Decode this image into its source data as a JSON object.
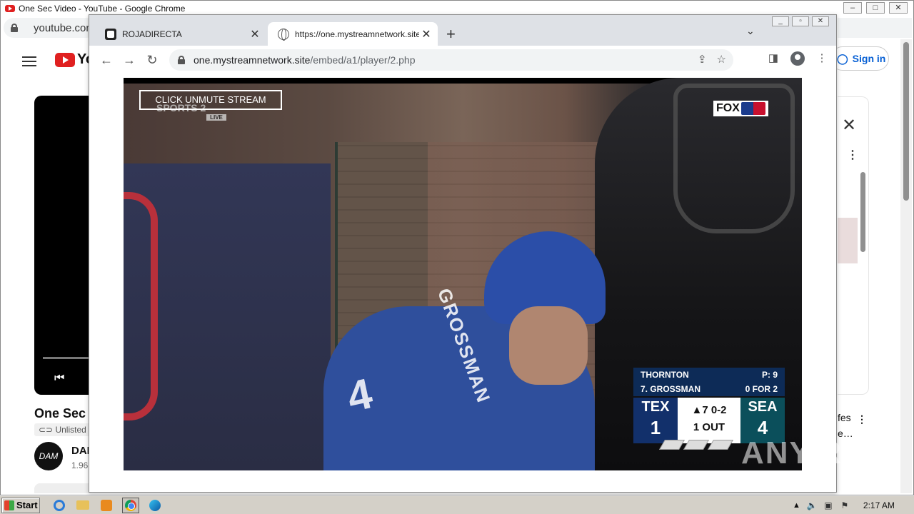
{
  "back_window": {
    "title": "One Sec Video - YouTube - Google Chrome",
    "address": "youtube.com",
    "controls": [
      "–",
      "□",
      "✕"
    ],
    "youtube": {
      "logo": "Yo",
      "sign_in": "Sign in",
      "video_title": "One Sec",
      "unlisted": "Unlisted",
      "avatar_text": "DAM",
      "channel": "DAI",
      "subs": "1.96",
      "recs_text": "fes",
      "recs_text2": "e…"
    }
  },
  "front_window": {
    "controls": [
      "_",
      "▫",
      "✕"
    ],
    "tabs": [
      {
        "title": "ROJADIRECTA",
        "active": false
      },
      {
        "title": "https://one.mystreamnetwork.site/e",
        "active": true
      }
    ],
    "url_host": "one.mystreamnetwork.site",
    "url_path": "/embed/a1/player/2.php",
    "player": {
      "unmute_label": "CLICK UNMUTE STREAM",
      "channel_logo": "SPORTS 2",
      "channel_live": "LIVE",
      "broadcaster": "FOX",
      "jersey_name": "GROSSMAN",
      "jersey_number": "4",
      "scorebug": {
        "pitcher": "THORNTON",
        "pitch_count": "P: 9",
        "batter": "7. GROSSMAN",
        "batter_stats": "0 FOR 2",
        "away_team": "TEX",
        "away_score": "1",
        "home_team": "SEA",
        "home_score": "4",
        "inning": "▲7 0-2",
        "outs": "1 OUT"
      }
    }
  },
  "watermark": "ANY.RUN",
  "taskbar": {
    "start_label": "Start",
    "clock": "2:17 AM"
  }
}
